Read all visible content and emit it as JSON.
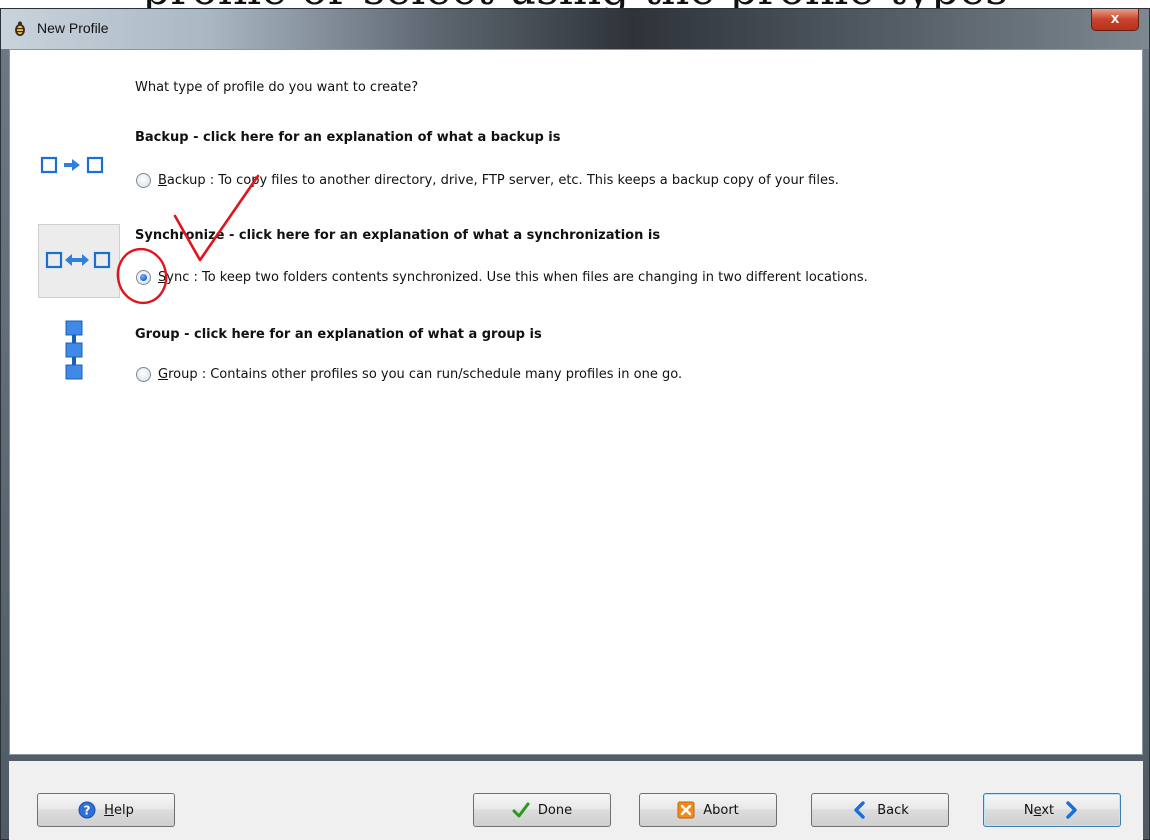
{
  "window": {
    "title": "New Profile",
    "close_label": "x"
  },
  "top_caption": "profile or select using the profile types",
  "content": {
    "question": "What type of profile do you want to create?",
    "options": [
      {
        "heading": "Backup - click here for an explanation of what a backup is",
        "mnemonic": "B",
        "label_rest": "ackup : To copy files to another directory, drive, FTP server, etc. This keeps a backup copy of your files.",
        "checked": false,
        "icon": "backup-arrow-icon"
      },
      {
        "heading": "Synchronize - click here for an explanation of what a synchronization is",
        "mnemonic": "S",
        "label_rest": "ync : To keep two folders contents synchronized. Use this when files are changing in two different locations.",
        "checked": true,
        "icon": "sync-double-arrow-icon"
      },
      {
        "heading": "Group - click here for an explanation of what a group is",
        "mnemonic": "G",
        "label_rest": "roup : Contains other profiles so you can run/schedule many profiles in one go.",
        "checked": false,
        "icon": "group-tree-icon"
      }
    ]
  },
  "buttons": {
    "help": {
      "mnemonic": "H",
      "rest": "elp"
    },
    "done": "Done",
    "abort": "Abort",
    "back": "Back",
    "next": {
      "pre": "N",
      "mnemonic": "e",
      "rest": "xt"
    }
  },
  "colors": {
    "accent_blue": "#1a6fd6",
    "annotation_red": "#e0141e",
    "done_green": "#2a9a1e",
    "abort_orange": "#f08a1c"
  }
}
